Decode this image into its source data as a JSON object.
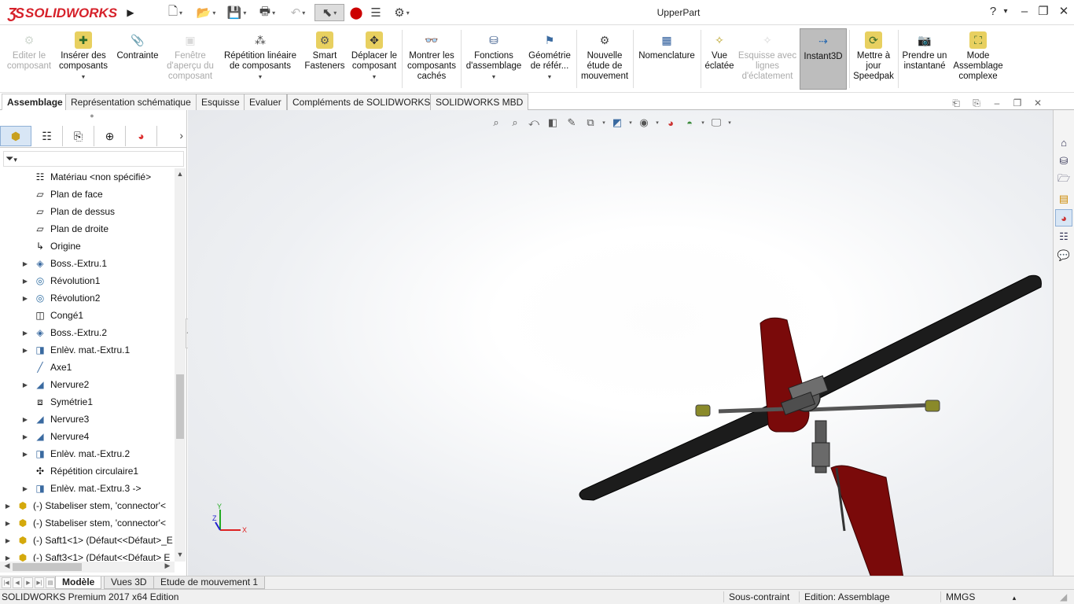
{
  "app": {
    "logo_text": "SOLIDWORKS",
    "document_title": "UpperPart"
  },
  "quick_access": {
    "icons": [
      "new-file-icon",
      "open-file-icon",
      "save-icon",
      "print-icon",
      "undo-icon",
      "select-icon",
      "rebuild-icon",
      "file-properties-icon",
      "options-icon"
    ]
  },
  "window_controls": {
    "help": "?",
    "help_dropdown": "▾",
    "minimize": "–",
    "restore": "❐",
    "close": "✕"
  },
  "ribbon": {
    "buttons": [
      {
        "label": "Editer le composant",
        "icon": "edit-component-icon",
        "disabled": true
      },
      {
        "label": "Insérer des composants",
        "icon": "insert-components-icon",
        "dropdown": true
      },
      {
        "label": "Contrainte",
        "icon": "mate-icon"
      },
      {
        "label": "Fenêtre d'aperçu du composant",
        "icon": "component-preview-icon",
        "disabled": true
      },
      {
        "label": "Répétition linéaire de composants",
        "icon": "linear-pattern-icon",
        "dropdown": true
      },
      {
        "label": "Smart Fasteners",
        "icon": "smart-fasteners-icon"
      },
      {
        "label": "Déplacer le composant",
        "icon": "move-component-icon",
        "dropdown": true
      },
      {
        "label": "Montrer les composants cachés",
        "icon": "show-hidden-icon"
      },
      {
        "label": "Fonctions d'assemblage",
        "icon": "assembly-features-icon",
        "dropdown": true
      },
      {
        "label": "Géométrie de référ...",
        "icon": "reference-geometry-icon",
        "dropdown": true
      },
      {
        "label": "Nouvelle étude de mouvement",
        "icon": "motion-study-icon"
      },
      {
        "label": "Nomenclature",
        "icon": "bom-icon"
      },
      {
        "label": "Vue éclatée",
        "icon": "exploded-view-icon"
      },
      {
        "label": "Esquisse avec lignes d'éclatement",
        "icon": "explode-line-sketch-icon",
        "disabled": true
      },
      {
        "label": "Instant3D",
        "icon": "instant3d-icon",
        "active": true
      },
      {
        "label": "Mettre à jour Speedpak",
        "icon": "speedpak-icon"
      },
      {
        "label": "Prendre un instantané",
        "icon": "snapshot-icon"
      },
      {
        "label": "Mode Assemblage complexe",
        "icon": "large-assembly-icon"
      }
    ]
  },
  "command_tabs": [
    {
      "label": "Assemblage",
      "active": true
    },
    {
      "label": "Représentation schématique"
    },
    {
      "label": "Esquisse"
    },
    {
      "label": "Evaluer"
    },
    {
      "label": "Compléments de SOLIDWORKS"
    },
    {
      "label": "SOLIDWORKS MBD"
    }
  ],
  "feature_tree": {
    "filter_label": "▾",
    "items": [
      {
        "label": "Matériau <non spécifié>",
        "icon": "material-icon",
        "expandable": false,
        "level": 1
      },
      {
        "label": "Plan de face",
        "icon": "plane-icon",
        "expandable": false,
        "level": 1
      },
      {
        "label": "Plan de dessus",
        "icon": "plane-icon",
        "expandable": false,
        "level": 1
      },
      {
        "label": "Plan de droite",
        "icon": "plane-icon",
        "expandable": false,
        "level": 1
      },
      {
        "label": "Origine",
        "icon": "origin-icon",
        "expandable": false,
        "level": 1
      },
      {
        "label": "Boss.-Extru.1",
        "icon": "boss-extrude-icon",
        "expandable": true,
        "level": 1
      },
      {
        "label": "Révolution1",
        "icon": "revolve-icon",
        "expandable": true,
        "level": 1
      },
      {
        "label": "Révolution2",
        "icon": "revolve-icon",
        "expandable": true,
        "level": 1
      },
      {
        "label": "Congé1",
        "icon": "fillet-icon",
        "expandable": false,
        "level": 1
      },
      {
        "label": "Boss.-Extru.2",
        "icon": "boss-extrude-icon",
        "expandable": true,
        "level": 1
      },
      {
        "label": "Enlèv. mat.-Extru.1",
        "icon": "cut-extrude-icon",
        "expandable": true,
        "level": 1
      },
      {
        "label": "Axe1",
        "icon": "axis-icon",
        "expandable": false,
        "level": 1
      },
      {
        "label": "Nervure2",
        "icon": "rib-icon",
        "expandable": true,
        "level": 1
      },
      {
        "label": "Symétrie1",
        "icon": "mirror-icon",
        "expandable": false,
        "level": 1
      },
      {
        "label": "Nervure3",
        "icon": "rib-icon",
        "expandable": true,
        "level": 1
      },
      {
        "label": "Nervure4",
        "icon": "rib-icon",
        "expandable": true,
        "level": 1
      },
      {
        "label": "Enlèv. mat.-Extru.2",
        "icon": "cut-extrude-icon",
        "expandable": true,
        "level": 1
      },
      {
        "label": "Répétition circulaire1",
        "icon": "circular-pattern-icon",
        "expandable": false,
        "level": 1
      },
      {
        "label": "Enlèv. mat.-Extru.3 ->",
        "icon": "cut-extrude-icon",
        "expandable": true,
        "level": 1
      },
      {
        "label": "(-) Stabeliser stem, 'connector'<",
        "icon": "part-icon",
        "expandable": true,
        "level": 0
      },
      {
        "label": "(-) Stabeliser stem, 'connector'<",
        "icon": "part-icon",
        "expandable": true,
        "level": 0
      },
      {
        "label": "(-) Saft1<1> (Défaut<<Défaut>_E",
        "icon": "part-icon",
        "expandable": true,
        "level": 0
      },
      {
        "label": "(-) Saft3<1> (Défaut<<Défaut> E",
        "icon": "part-icon",
        "expandable": true,
        "level": 0
      }
    ]
  },
  "panel_tabs": [
    "featuremanager-icon",
    "propertymanager-icon",
    "configurationmanager-icon",
    "dimxpert-icon",
    "appearance-icon"
  ],
  "heads_up_toolbar": [
    "zoom-to-fit-icon",
    "zoom-area-icon",
    "previous-view-icon",
    "section-view-icon",
    "dynamic-annotation-icon",
    "view-orientation-icon",
    "display-style-icon",
    "hide-show-icon",
    "edit-appearance-icon",
    "apply-scene-icon",
    "view-settings-icon"
  ],
  "triad": {
    "x_label": "X",
    "y_label": "Y",
    "z_label": "Z"
  },
  "model": {
    "blade_color": "#1c1c1c",
    "fin_color": "#7a0a0a",
    "hub_color": "#5a5a5a",
    "tip_color": "#8a8a2a"
  },
  "task_pane": [
    "home-icon",
    "design-library-icon",
    "file-explorer-icon",
    "view-palette-icon",
    "appearances-icon",
    "custom-properties-icon",
    "forum-icon"
  ],
  "bottom_tabs": [
    {
      "label": "Modèle",
      "active": true
    },
    {
      "label": "Vues 3D"
    },
    {
      "label": "Etude de mouvement 1"
    }
  ],
  "status_bar": {
    "product": "SOLIDWORKS Premium 2017 x64 Edition",
    "constraint": "Sous-contraint",
    "mode": "Edition: Assemblage",
    "units": "MMGS",
    "units_arrow": "▴"
  }
}
